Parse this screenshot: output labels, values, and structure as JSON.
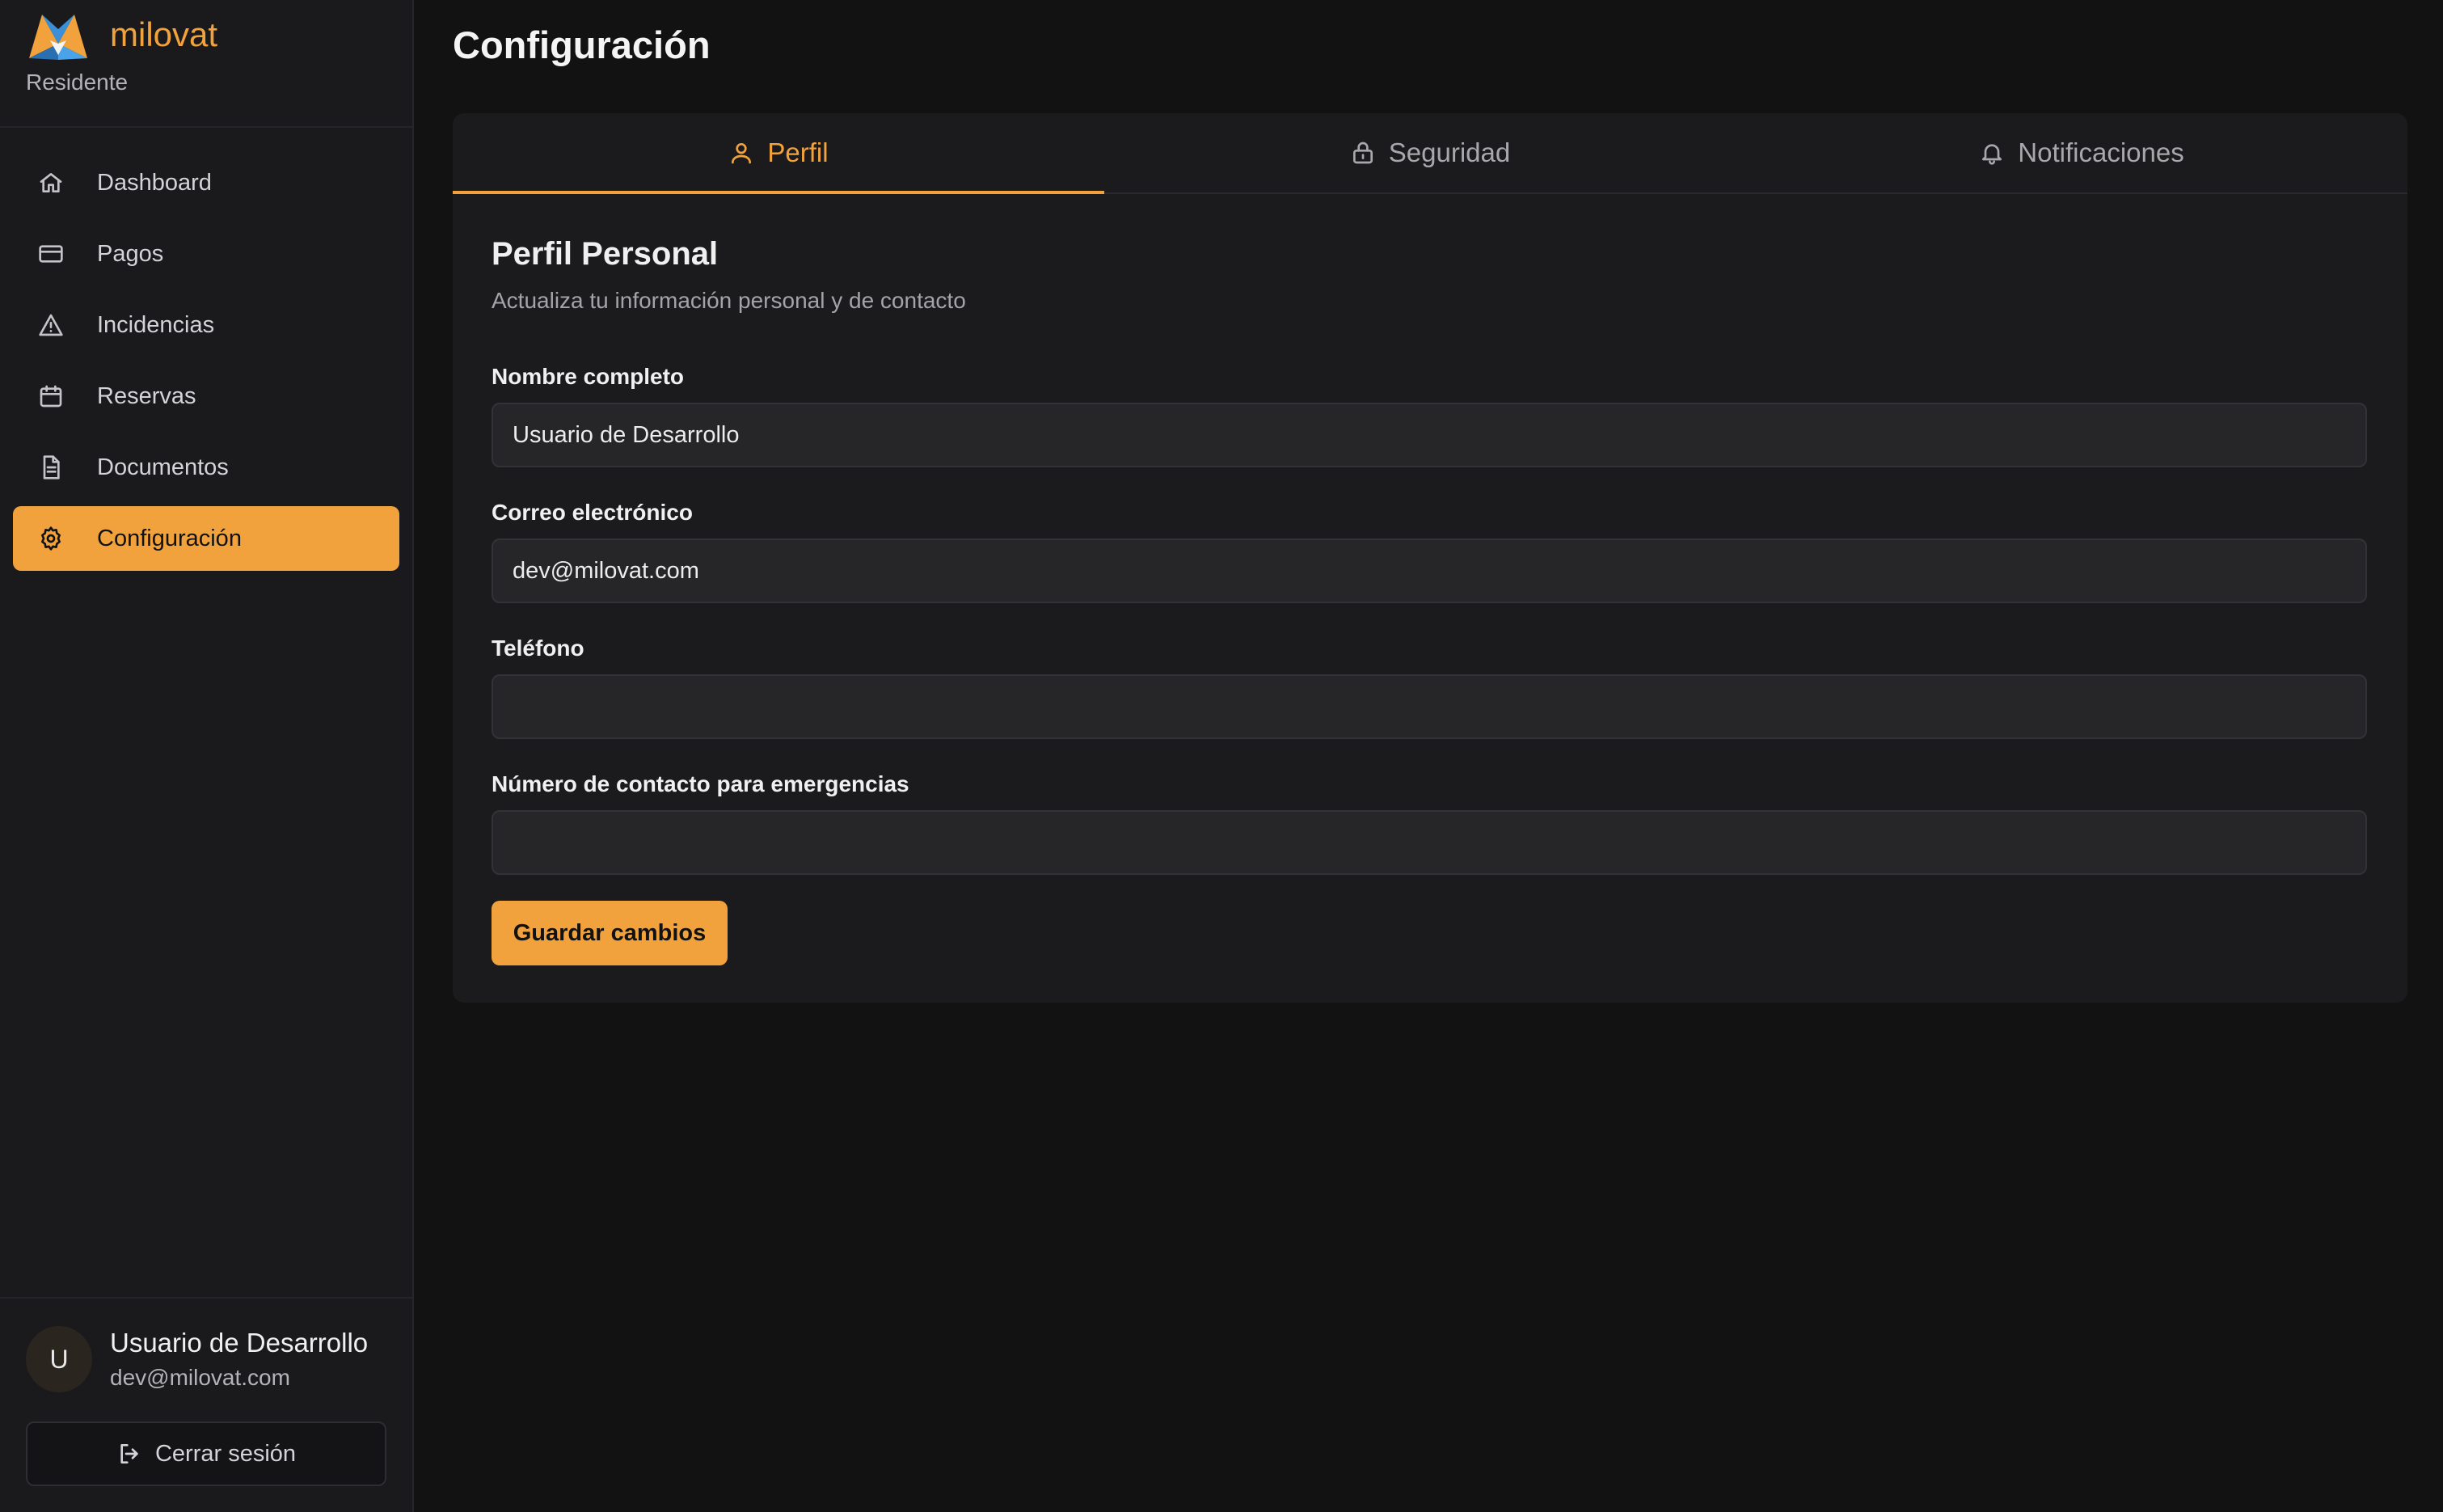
{
  "brand": {
    "name": "milovat",
    "role": "Residente"
  },
  "nav": [
    {
      "label": "Dashboard",
      "icon": "home-icon",
      "active": false
    },
    {
      "label": "Pagos",
      "icon": "credit-card-icon",
      "active": false
    },
    {
      "label": "Incidencias",
      "icon": "warning-triangle-icon",
      "active": false
    },
    {
      "label": "Reservas",
      "icon": "calendar-icon",
      "active": false
    },
    {
      "label": "Documentos",
      "icon": "document-icon",
      "active": false
    },
    {
      "label": "Configuración",
      "icon": "gear-icon",
      "active": true
    }
  ],
  "user": {
    "initial": "U",
    "name": "Usuario de Desarrollo",
    "email": "dev@milovat.com"
  },
  "logout_label": "Cerrar sesión",
  "page_title": "Configuración",
  "tabs": [
    {
      "label": "Perfil",
      "icon": "user-icon",
      "active": true
    },
    {
      "label": "Seguridad",
      "icon": "lock-icon",
      "active": false
    },
    {
      "label": "Notificaciones",
      "icon": "bell-icon",
      "active": false
    }
  ],
  "profile": {
    "title": "Perfil Personal",
    "subtitle": "Actualiza tu información personal y de contacto",
    "fields": [
      {
        "label": "Nombre completo",
        "value": "Usuario de Desarrollo",
        "placeholder": ""
      },
      {
        "label": "Correo electrónico",
        "value": "dev@milovat.com",
        "placeholder": ""
      },
      {
        "label": "Teléfono",
        "value": "",
        "placeholder": ""
      },
      {
        "label": "Número de contacto para emergencias",
        "value": "",
        "placeholder": ""
      }
    ],
    "save_label": "Guardar cambios"
  },
  "colors": {
    "accent": "#f2a23c",
    "background": "#121212",
    "sidebar": "#1a1a1c",
    "panel": "#1b1b1d"
  }
}
